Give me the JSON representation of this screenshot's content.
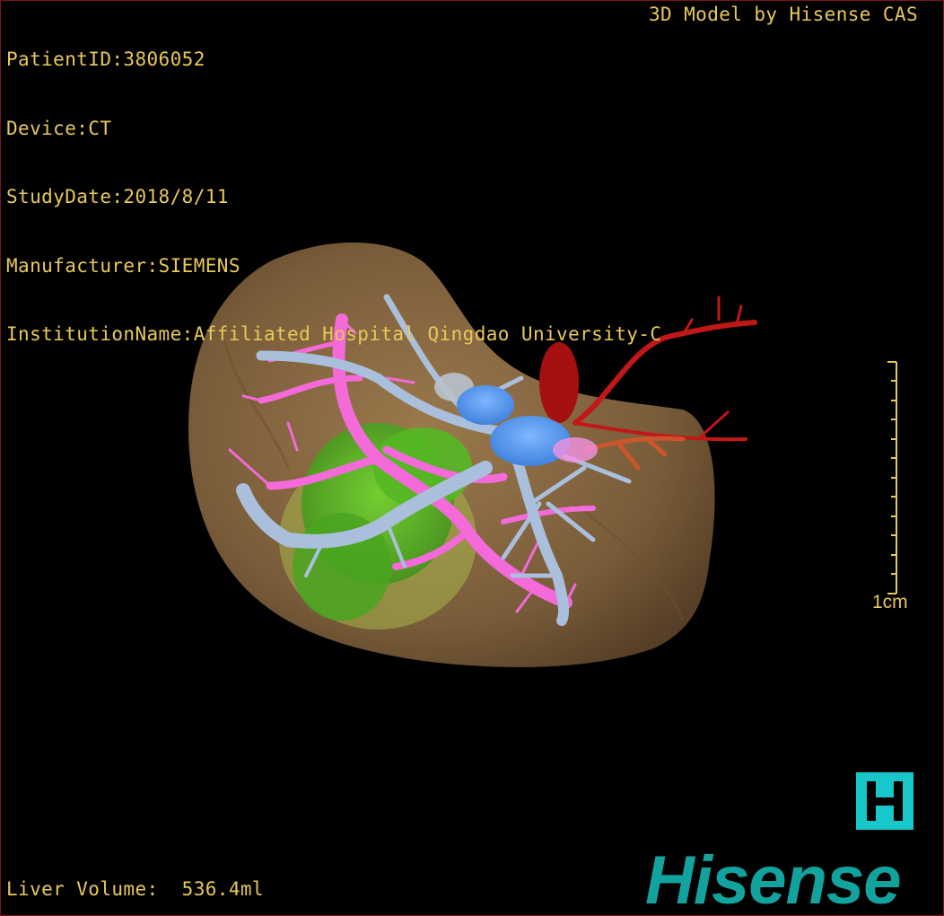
{
  "study_info": {
    "patient_id": "PatientID:3806052",
    "device": "Device:CT",
    "study_date": "StudyDate:2018/8/11",
    "manufacturer": "Manufacturer:SIEMENS",
    "institution": "InstitutionName:Affiliated Hospital Qingdao University-C"
  },
  "credit": "3D Model by Hisense CAS",
  "liver_volume": "Liver Volume:  536.4ml",
  "scale_bar": {
    "label": "1cm"
  },
  "logo": {
    "badge_letter": "H",
    "wordmark": "Hisense"
  },
  "colors": {
    "text": "#e8c95a",
    "liver": "#8a6a43",
    "portal_vein": "#a9bfdc",
    "hepatic_vein": "#f36ad8",
    "artery": "#c01818",
    "tumor": "#5fbf2a",
    "logo": "#13a39f"
  }
}
